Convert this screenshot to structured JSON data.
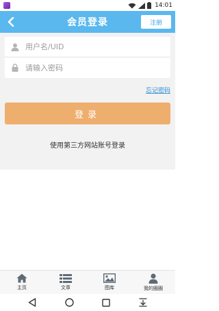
{
  "status_bar": {
    "time": "14:01",
    "icons": [
      "app-notification-icon",
      "wifi-icon",
      "signal-icon",
      "battery-icon"
    ]
  },
  "header": {
    "title": "会员登录",
    "register_label": "注册",
    "back_icon": "chevron-left-icon",
    "background_color": "#5ab8ee"
  },
  "form": {
    "username_placeholder": "用户名/UID",
    "password_placeholder": "请输入密码",
    "username_icon": "user-icon",
    "password_icon": "lock-icon"
  },
  "forgot_password_label": "忘记密码",
  "login_button_label": "登录",
  "login_button_color": "#eeae6e",
  "third_party_login_label": "使用第三方网站账号登录",
  "tabs": [
    {
      "label": "主页",
      "icon": "home-icon"
    },
    {
      "label": "文章",
      "icon": "list-icon"
    },
    {
      "label": "图库",
      "icon": "image-icon"
    },
    {
      "label": "我的圈圈",
      "icon": "person-icon"
    }
  ],
  "nav_bar": {
    "icons": [
      "back-triangle-icon",
      "home-circle-icon",
      "recents-square-icon",
      "download-icon"
    ]
  }
}
